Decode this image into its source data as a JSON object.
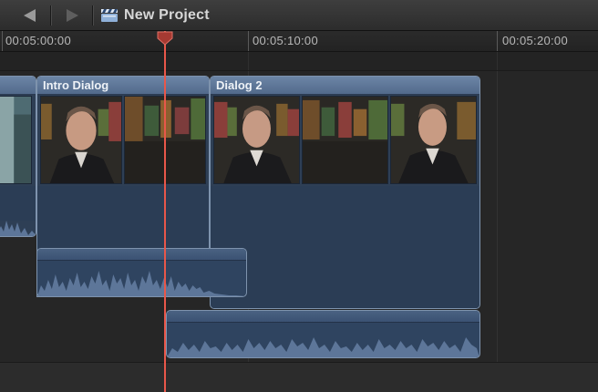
{
  "toolbar": {
    "back_icon": "back-arrow-icon",
    "forward_icon": "forward-arrow-icon",
    "project_icon": "clapperboard-icon",
    "project_title": "New Project"
  },
  "ruler": {
    "timecodes": [
      "00:05:00:00",
      "00:05:10:00",
      "00:05:20:00"
    ]
  },
  "clips": {
    "left_clip": {
      "name": ""
    },
    "intro": {
      "name": "Intro Dialog"
    },
    "dialog2": {
      "name": "Dialog 2"
    }
  },
  "colors": {
    "clip_header": "#6c85a6",
    "clip_body": "#2e3f55",
    "playhead": "#e8574a",
    "waveform": "#5d7699"
  }
}
